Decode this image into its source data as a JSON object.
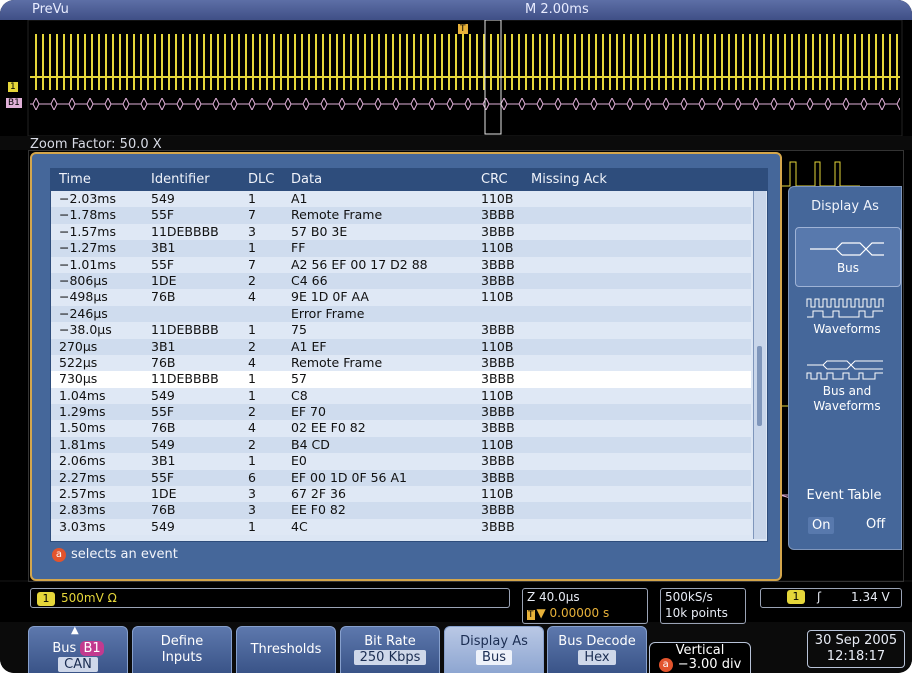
{
  "topbar": {
    "app": "PreVu",
    "timebase": "M 2.00ms"
  },
  "overview": {
    "zoom_label": "Zoom Factor: 50.0 X",
    "ch1_marker": "1",
    "bus_marker": "B1",
    "trigger_marker": "T"
  },
  "colors": {
    "ch1": "#e5d63a",
    "bus": "#e0b0d8",
    "accent": "#d4a64c",
    "panel": "#45679a",
    "selected_row": "#ffffff"
  },
  "table": {
    "headers": [
      "Time",
      "Identifier",
      "DLC",
      "Data",
      "CRC",
      "Missing Ack"
    ],
    "rows": [
      [
        "−2.03ms",
        "549",
        "1",
        "A1",
        "110B",
        ""
      ],
      [
        "−1.78ms",
        "55F",
        "7",
        "Remote Frame",
        "3BBB",
        ""
      ],
      [
        "−1.57ms",
        "11DEBBBB",
        "3",
        "57 B0 3E",
        "3BBB",
        ""
      ],
      [
        "−1.27ms",
        "3B1",
        "1",
        "FF",
        "110B",
        ""
      ],
      [
        "−1.01ms",
        "55F",
        "7",
        "A2 56 EF 00 17 D2 88",
        "3BBB",
        ""
      ],
      [
        "−806µs",
        "1DE",
        "2",
        "C4 66",
        "3BBB",
        ""
      ],
      [
        "−498µs",
        "76B",
        "4",
        "9E 1D 0F AA",
        "110B",
        ""
      ],
      [
        "−246µs",
        "",
        "",
        "Error Frame",
        "",
        ""
      ],
      [
        "−38.0µs",
        "11DEBBBB",
        "1",
        "75",
        "3BBB",
        ""
      ],
      [
        "270µs",
        "3B1",
        "2",
        "A1 EF",
        "110B",
        ""
      ],
      [
        "522µs",
        "76B",
        "4",
        "Remote Frame",
        "3BBB",
        ""
      ],
      [
        "730µs",
        "11DEBBBB",
        "1",
        "57",
        "3BBB",
        ""
      ],
      [
        "1.04ms",
        "549",
        "1",
        "C8",
        "110B",
        ""
      ],
      [
        "1.29ms",
        "55F",
        "2",
        "EF 70",
        "3BBB",
        ""
      ],
      [
        "1.50ms",
        "76B",
        "4",
        "02 EE F0 82",
        "3BBB",
        ""
      ],
      [
        "1.81ms",
        "549",
        "2",
        "B4 CD",
        "110B",
        ""
      ],
      [
        "2.06ms",
        "3B1",
        "1",
        "E0",
        "3BBB",
        ""
      ],
      [
        "2.27ms",
        "55F",
        "6",
        "EF 00 1D 0F 56 A1",
        "3BBB",
        ""
      ],
      [
        "2.57ms",
        "1DE",
        "3",
        "67 2F 36",
        "110B",
        ""
      ],
      [
        "2.83ms",
        "76B",
        "3",
        "EE F0 82",
        "3BBB",
        ""
      ],
      [
        "3.03ms",
        "549",
        "1",
        "4C",
        "3BBB",
        ""
      ]
    ],
    "selected_row_index": 11,
    "hint_badge": "a",
    "hint": "selects an event"
  },
  "side_panel": {
    "title": "Display As",
    "options": [
      {
        "label": "Bus",
        "active": true
      },
      {
        "label": "Waveforms",
        "active": false
      },
      {
        "label": "Bus and Waveforms",
        "active": false
      }
    ],
    "event_table": {
      "title": "Event Table",
      "on": "On",
      "off": "Off"
    }
  },
  "status": {
    "ch1_badge": "1",
    "ch1_scale": "500mV Ω",
    "zoom_time": "Z 40.0µs",
    "trigger_pos": "▼ 0.00000 s",
    "sample_rate": "500kS/s",
    "record": "10k points",
    "trig_ch": "1",
    "trig_slope": "ʃ",
    "trig_level": "1.34 V"
  },
  "menu": {
    "bus": {
      "l1": "Bus",
      "badge": "B1",
      "l2": "CAN"
    },
    "define_inputs": {
      "l1": "Define",
      "l2": "Inputs"
    },
    "thresholds": {
      "l1": "Thresholds"
    },
    "bit_rate": {
      "l1": "Bit Rate",
      "l2": "250 Kbps"
    },
    "display_as": {
      "l1": "Display As",
      "l2": "Bus"
    },
    "bus_decode": {
      "l1": "Bus Decode",
      "l2": "Hex"
    },
    "vertical": {
      "l1": "Vertical",
      "badge": "a",
      "l2": "−3.00 div"
    },
    "date": "30 Sep 2005",
    "time": "12:18:17"
  }
}
